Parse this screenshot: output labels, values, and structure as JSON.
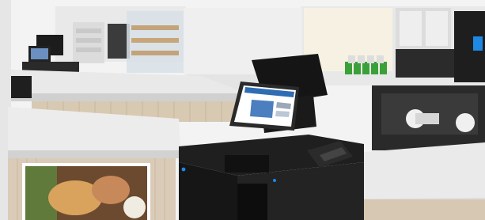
{
  "scene": {
    "description_kind": "photo-render",
    "colors": {
      "wall": "#f2f2f2",
      "counter_top": "#ececec",
      "counter_shadow": "#d6d6d6",
      "wood_panel": "#d9cbb8",
      "terminal_dark": "#1b1b1b",
      "screen_blue": "#2f6db3",
      "accent_green": "#3aa03a",
      "accent_blue_light": "#1e88e5"
    }
  },
  "pos_screen": {
    "text": ""
  }
}
